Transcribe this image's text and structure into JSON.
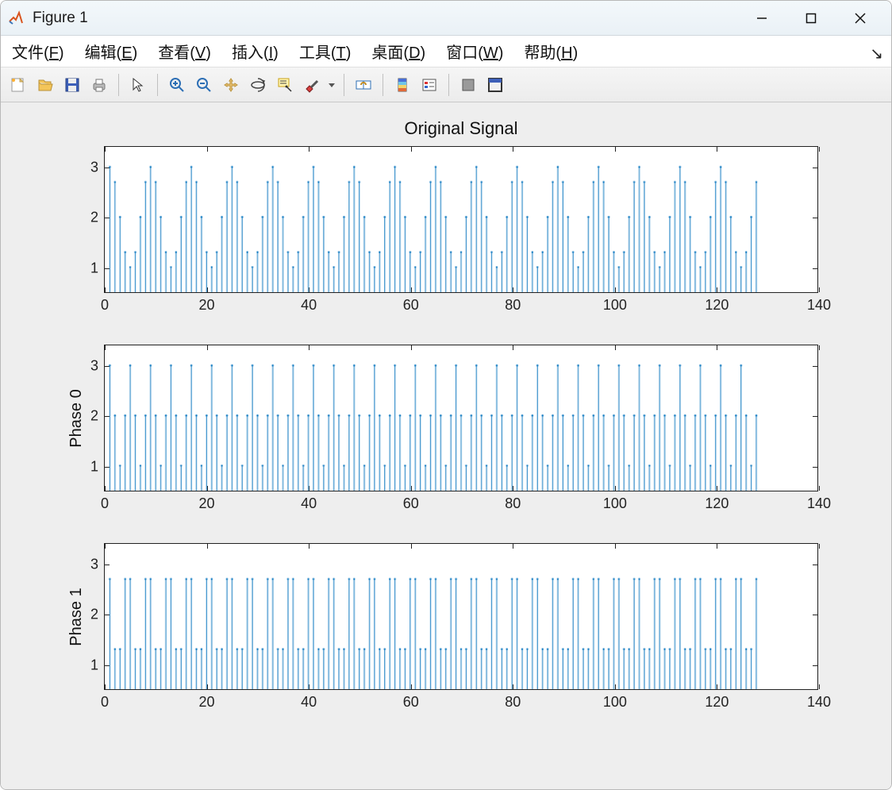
{
  "window": {
    "title": "Figure 1"
  },
  "menu": {
    "file": "文件(F)",
    "edit": "编辑(E)",
    "view": "查看(V)",
    "insert": "插入(I)",
    "tools": "工具(T)",
    "desktop": "桌面(D)",
    "window": "窗口(W)",
    "help": "帮助(H)"
  },
  "toolbar_icons": [
    "new-figure-icon",
    "open-icon",
    "save-icon",
    "print-icon",
    "|",
    "pointer-icon",
    "|",
    "zoom-in-icon",
    "zoom-out-icon",
    "pan-icon",
    "rotate3d-icon",
    "data-cursor-icon",
    "brush-icon",
    "brush-dropdown-icon",
    "|",
    "link-axes-icon",
    "|",
    "colorbar-icon",
    "legend-icon",
    "|",
    "hide-toolbar-icon",
    "dock-icon"
  ],
  "plots_meta": {
    "title": "Original Signal",
    "ylabels": [
      "",
      "Phase 0",
      "Phase 1"
    ],
    "xlim": [
      0,
      140
    ],
    "ylim": [
      0.5,
      3.4
    ],
    "yticks": [
      1,
      2,
      3
    ],
    "xticks": [
      0,
      20,
      40,
      60,
      80,
      100,
      120,
      140
    ],
    "stem_color": "#0072BD"
  },
  "chart_data": [
    {
      "type": "stem",
      "title": "Original Signal",
      "xlabel": "",
      "ylabel": "",
      "xlim": [
        0,
        140
      ],
      "ylim": [
        0.5,
        3.4
      ],
      "base_pattern": [
        3,
        2.7,
        2,
        1.3,
        1,
        1.3,
        2,
        2.7
      ],
      "repeats": 16,
      "description": "128-sample periodic signal x(n)=2+cos(2*pi*n/8), n=0..127 (rounded to one decimal)."
    },
    {
      "type": "stem",
      "title": "",
      "xlabel": "",
      "ylabel": "Phase 0",
      "xlim": [
        0,
        140
      ],
      "ylim": [
        0.5,
        3.4
      ],
      "base_pattern": [
        3,
        2,
        1,
        2,
        3,
        2,
        1,
        2
      ],
      "repeats": 16,
      "description": "Even-indexed polyphase component: pattern 3,2,1,2 repeated."
    },
    {
      "type": "stem",
      "title": "",
      "xlabel": "",
      "ylabel": "Phase 1",
      "xlim": [
        0,
        140
      ],
      "ylim": [
        0.5,
        3.4
      ],
      "base_pattern": [
        2.7,
        1.3,
        1.3,
        2.7,
        2.7,
        1.3,
        1.3,
        2.7
      ],
      "repeats": 16,
      "description": "Odd-indexed polyphase component: pattern 2.7,1.3,1.3,2.7 repeated."
    }
  ]
}
